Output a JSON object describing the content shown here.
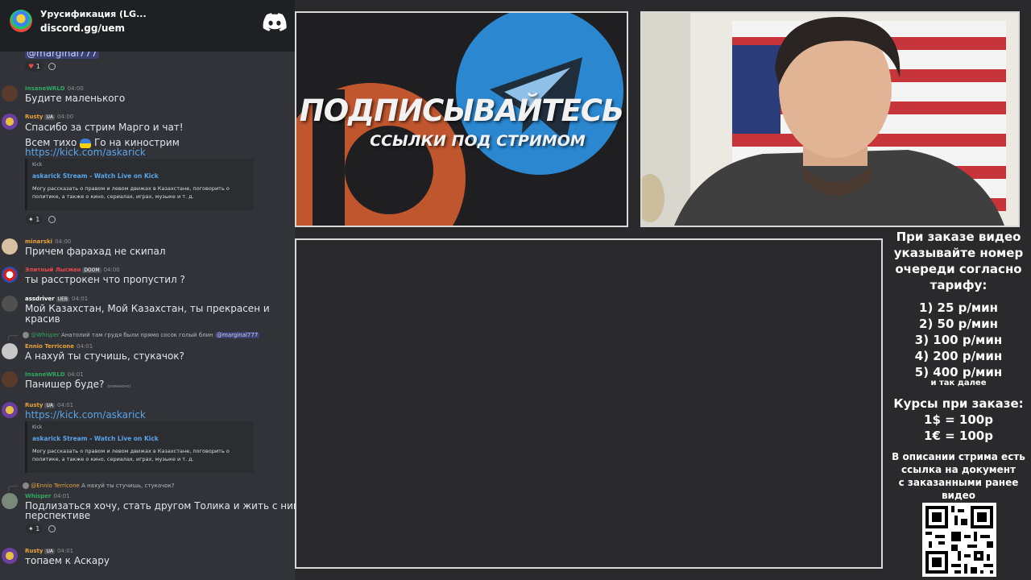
{
  "server": {
    "name": "Урусификация (LG...",
    "invite": "discord.gg/uem"
  },
  "messages": [
    {
      "text": "@marginal777",
      "reaction_count": "1"
    },
    {
      "user": "InsaneWRLD",
      "time": "04:00",
      "text": "Будите маленького"
    },
    {
      "user": "Rusty",
      "tags": [
        "UA"
      ],
      "time": "04:00",
      "text": "Спасибо за стрим Марго и чат!",
      "text2": "Всем тихо",
      "text2b": "Го на кинострим",
      "link": "https://kick.com/askarick",
      "embed": {
        "provider": "Kick",
        "title": "askarick Stream - Watch Live on Kick",
        "desc": "Могу рассказать о правом и левом движах в Казахстане, поговорить о политике, а также о кино, сериалах, играх, музыке и т. д."
      },
      "reaction_count": "1"
    },
    {
      "user": "minarski",
      "time": "04:00",
      "text": "Причем фарахад не скипал"
    },
    {
      "user": "Элитный Лысман",
      "tags": [
        "DOOM"
      ],
      "time": "04:00",
      "text": "ты расстрокен что пропустил ?"
    },
    {
      "user": "assdriver",
      "tags": [
        "UEB"
      ],
      "time": "04:01",
      "text": "Мой Казахстан, Мой Казахстан, ты прекрасен и",
      "text2": "красив"
    },
    {
      "reply_user": "@Whisper",
      "reply_text": "Анатолий там грудя были прямо сосок голый блин",
      "reply_mention": "@marginal777",
      "user": "Ennio Terricone",
      "time": "04:01",
      "text": "А нахуй ты стучишь, стукачок?"
    },
    {
      "user": "InsaneWRLD",
      "time": "04:01",
      "text": "Панишер буде?",
      "edited": "(изменено)"
    },
    {
      "user": "Rusty",
      "tags": [
        "UA"
      ],
      "time": "04:01",
      "link": "https://kick.com/askarick",
      "embed": {
        "provider": "Kick",
        "title": "askarick Stream - Watch Live on Kick",
        "desc": "Могу рассказать о правом и левом движах в Казахстане, поговорить о политике, а также о кино, сериалах, играх, музыке и т. д."
      }
    },
    {
      "reply_user": "@Ennio Terricone",
      "reply_text": "А нахуй ты стучишь, стукачок?",
      "user": "Whisper",
      "time": "04:01",
      "text": "Подлизаться хочу, стать другом Толика и жить с ним в",
      "text2": "перспективе",
      "reaction_count": "1"
    },
    {
      "user": "Rusty",
      "tags": [
        "UA"
      ],
      "time": "04:01",
      "text": "топаем к Аскару"
    }
  ],
  "promo": {
    "title": "ПОДПИСЫВАЙТЕСЬ",
    "subtitle": "ССЫЛКИ ПОД СТРИМОМ"
  },
  "info": {
    "heading": [
      "При заказе видео",
      "указывайте номер",
      "очереди согласно",
      "тарифу:"
    ],
    "tariffs": [
      "1) 25 р/мин",
      "2) 50 р/мин",
      "3) 100 р/мин",
      "4) 200 р/мин",
      "5) 400 р/мин"
    ],
    "etc": "и так далее",
    "rates_heading": "Курсы при заказе:",
    "rates": [
      "1$ = 100р",
      "1€ = 100р"
    ],
    "desc": [
      "В описании стрима есть",
      "ссылка на документ",
      "с заказанными ранее",
      "видео"
    ]
  },
  "colors": {
    "chat_bg": "#313338",
    "link": "#5aa4e8",
    "rusty": "#e8a33b",
    "insane": "#2fa85f",
    "minarski": "#e8a33b",
    "elite": "#e84848",
    "assdriver": "#ffffff",
    "ennio": "#e8a33b",
    "whisper": "#2fa85f"
  }
}
